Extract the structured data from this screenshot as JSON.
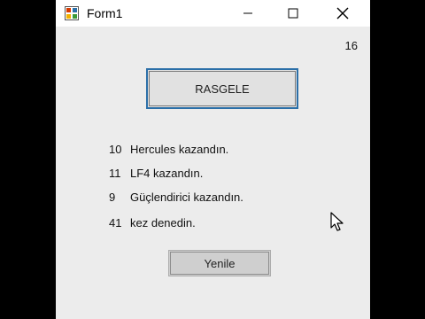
{
  "window": {
    "title": "Form1",
    "icon": "winforms-app-icon",
    "controls": {
      "minimize": "minimize-icon",
      "maximize": "maximize-icon",
      "close": "close-icon"
    }
  },
  "form": {
    "counter": "16",
    "random_button_label": "RASGELE",
    "results": [
      {
        "count": "10",
        "text": "Hercules kazandın."
      },
      {
        "count": "11",
        "text": "LF4 kazandın."
      },
      {
        "count": "9",
        "text": "Güçlendirici kazandın."
      },
      {
        "count": "41",
        "text": "kez denedin."
      }
    ],
    "reset_button_label": "Yenile"
  },
  "colors": {
    "focus_border": "#2b6fa8",
    "form_background": "#ececec",
    "outer_background": "#000000"
  },
  "cursor": "mouse-pointer-icon"
}
